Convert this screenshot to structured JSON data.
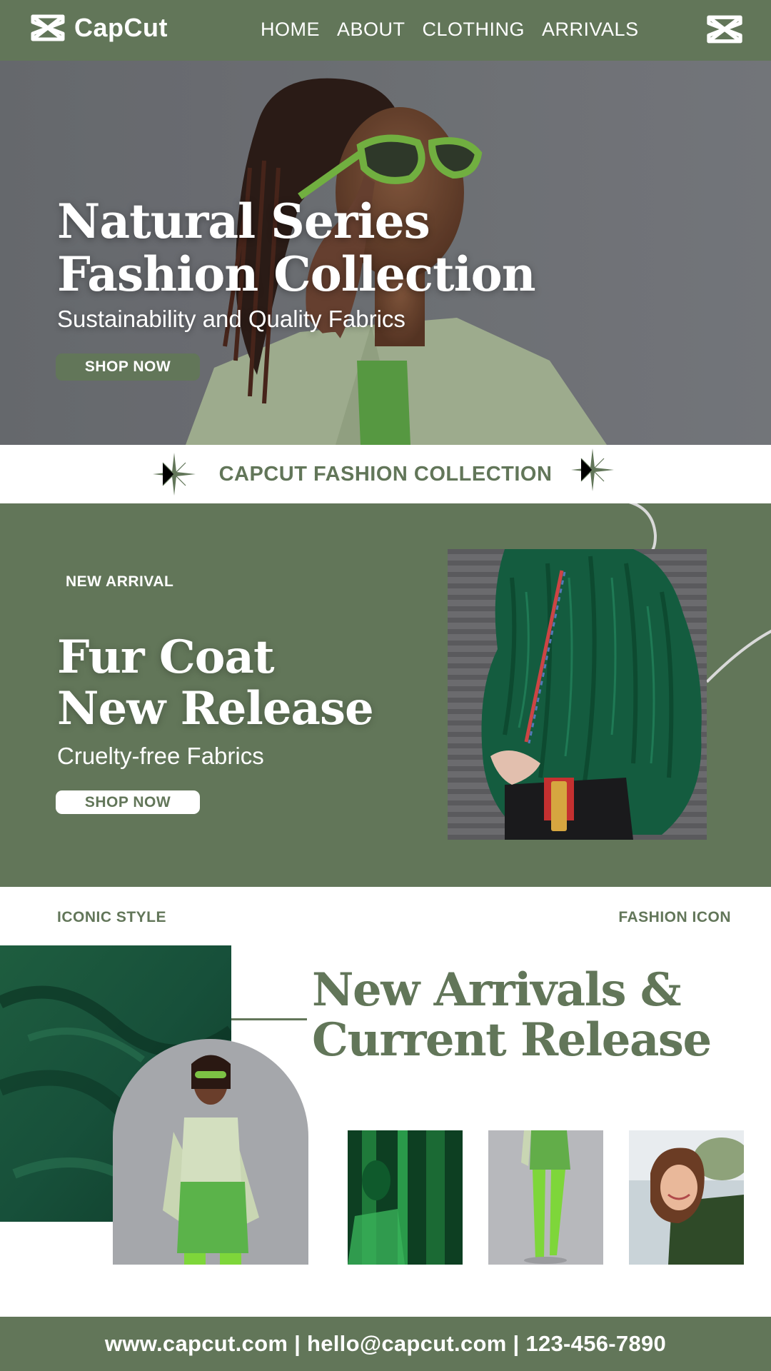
{
  "nav": {
    "brand": "CapCut",
    "links": [
      "HOME",
      "ABOUT",
      "CLOTHING",
      "ARRIVALS"
    ],
    "logo_icon": "capcut-logo-icon",
    "menu_icon": "capcut-logo-icon"
  },
  "hero": {
    "title_line1": "Natural Series",
    "title_line2": "Fashion Collection",
    "subtitle": "Sustainability and Quality Fabrics",
    "button": "SHOP NOW"
  },
  "banner": {
    "text": "CAPCUT FASHION COLLECTION"
  },
  "feature": {
    "label": "NEW ARRIVAL",
    "title_line1": "Fur Coat",
    "title_line2": "New Release",
    "subtitle": "Cruelty-free Fabrics",
    "button": "SHOP NOW"
  },
  "iconic": {
    "left_label": "ICONIC STYLE",
    "right_label": "FASHION ICON",
    "title_line1": "New Arrivals &",
    "title_line2": "Current Release"
  },
  "footer": {
    "contact": "www.capcut.com | hello@capcut.com | 123-456-7890"
  },
  "colors": {
    "brand_green": "#627659",
    "white": "#ffffff"
  }
}
